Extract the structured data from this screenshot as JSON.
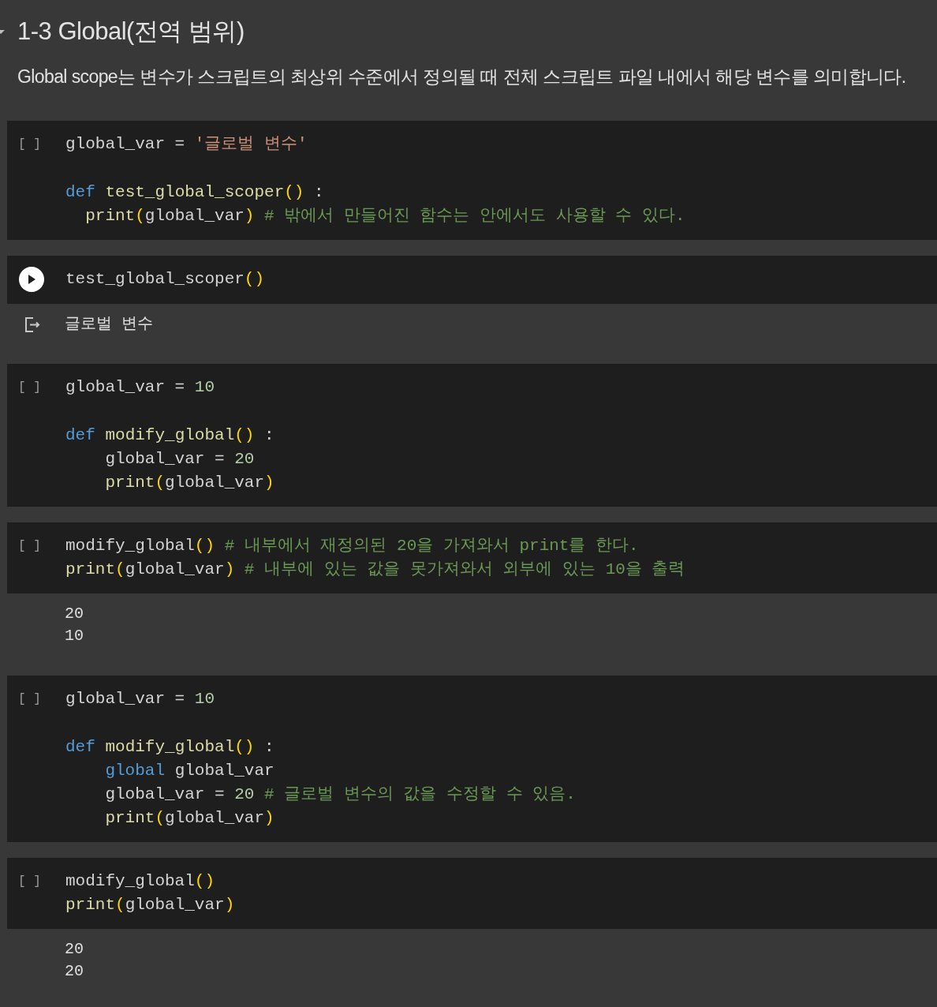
{
  "heading": {
    "title": "1-3 Global(전역 범위)",
    "expanded": true
  },
  "description": "Global scope는 변수가 스크립트의 최상위 수준에서 정의될 때 전체 스크립트 파일 내에서 해당 변수를 의미합니다.",
  "cells": [
    {
      "kind": "idle",
      "prompt": "[ ]",
      "blocks": [
        [
          {
            "tokens": [
              {
                "kind": "plain",
                "text": "global_var = "
              },
              {
                "kind": "string",
                "text": "'글로벌 변수'"
              }
            ]
          }
        ],
        [
          {
            "tokens": [
              {
                "kind": "keyword",
                "text": "def "
              },
              {
                "kind": "func",
                "text": "test_global_scoper"
              },
              {
                "kind": "paren",
                "text": "()"
              },
              {
                "kind": "plain",
                "text": " :"
              }
            ]
          },
          {
            "tokens": [
              {
                "kind": "func",
                "text": "  print"
              },
              {
                "kind": "paren",
                "text": "("
              },
              {
                "kind": "plain",
                "text": "global_var"
              },
              {
                "kind": "paren",
                "text": ")"
              },
              {
                "kind": "comment",
                "text": " # 밖에서 만들어진 함수는 안에서도 사용할 수 있다."
              }
            ]
          }
        ]
      ]
    },
    {
      "kind": "run_button",
      "blocks": [
        [
          {
            "tokens": [
              {
                "kind": "plain",
                "text": "test_global_scoper"
              },
              {
                "kind": "paren",
                "text": "()"
              }
            ]
          }
        ]
      ],
      "output_icon": true,
      "output": [
        "글로벌 변수"
      ]
    },
    {
      "kind": "idle",
      "prompt": "[ ]",
      "blocks": [
        [
          {
            "tokens": [
              {
                "kind": "plain",
                "text": "global_var = "
              },
              {
                "kind": "number",
                "text": "10"
              }
            ]
          }
        ],
        [
          {
            "tokens": [
              {
                "kind": "keyword",
                "text": "def "
              },
              {
                "kind": "func",
                "text": "modify_global"
              },
              {
                "kind": "paren",
                "text": "()"
              },
              {
                "kind": "plain",
                "text": " :"
              }
            ]
          },
          {
            "tokens": [
              {
                "kind": "plain",
                "text": "    global_var = "
              },
              {
                "kind": "number",
                "text": "20"
              }
            ]
          },
          {
            "tokens": [
              {
                "kind": "func",
                "text": "    print"
              },
              {
                "kind": "paren",
                "text": "("
              },
              {
                "kind": "plain",
                "text": "global_var"
              },
              {
                "kind": "paren",
                "text": ")"
              }
            ]
          }
        ]
      ]
    },
    {
      "kind": "idle",
      "prompt": "[ ]",
      "blocks": [
        [
          {
            "tokens": [
              {
                "kind": "plain",
                "text": "modify_global"
              },
              {
                "kind": "paren",
                "text": "()"
              },
              {
                "kind": "comment",
                "text": " # 내부에서 재정의된 20을 가져와서 print를 한다."
              }
            ]
          },
          {
            "tokens": [
              {
                "kind": "func",
                "text": "print"
              },
              {
                "kind": "paren",
                "text": "("
              },
              {
                "kind": "plain",
                "text": "global_var"
              },
              {
                "kind": "paren",
                "text": ")"
              },
              {
                "kind": "comment",
                "text": " # 내부에 있는 값을 못가져와서 외부에 있는 10을 출력"
              }
            ]
          }
        ]
      ],
      "output_icon": false,
      "output": [
        "20",
        "10"
      ]
    },
    {
      "kind": "idle",
      "prompt": "[ ]",
      "blocks": [
        [
          {
            "tokens": [
              {
                "kind": "plain",
                "text": "global_var = "
              },
              {
                "kind": "number",
                "text": "10"
              }
            ]
          }
        ],
        [
          {
            "tokens": [
              {
                "kind": "keyword",
                "text": "def "
              },
              {
                "kind": "func",
                "text": "modify_global"
              },
              {
                "kind": "paren",
                "text": "()"
              },
              {
                "kind": "plain",
                "text": " :"
              }
            ]
          },
          {
            "tokens": [
              {
                "kind": "keyword",
                "text": "    global"
              },
              {
                "kind": "plain",
                "text": " global_var"
              }
            ]
          },
          {
            "tokens": [
              {
                "kind": "plain",
                "text": "    global_var = "
              },
              {
                "kind": "number",
                "text": "20"
              },
              {
                "kind": "comment",
                "text": " # 글로벌 변수의 값을 수정할 수 있음."
              }
            ]
          },
          {
            "tokens": [
              {
                "kind": "func",
                "text": "    print"
              },
              {
                "kind": "paren",
                "text": "("
              },
              {
                "kind": "plain",
                "text": "global_var"
              },
              {
                "kind": "paren",
                "text": ")"
              }
            ]
          }
        ]
      ]
    },
    {
      "kind": "idle",
      "prompt": "[ ]",
      "blocks": [
        [
          {
            "tokens": [
              {
                "kind": "plain",
                "text": "modify_global"
              },
              {
                "kind": "paren",
                "text": "()"
              }
            ]
          },
          {
            "tokens": [
              {
                "kind": "func",
                "text": "print"
              },
              {
                "kind": "paren",
                "text": "("
              },
              {
                "kind": "plain",
                "text": "global_var"
              },
              {
                "kind": "paren",
                "text": ")"
              }
            ]
          }
        ]
      ],
      "output_icon": false,
      "output": [
        "20",
        "20"
      ]
    }
  ]
}
